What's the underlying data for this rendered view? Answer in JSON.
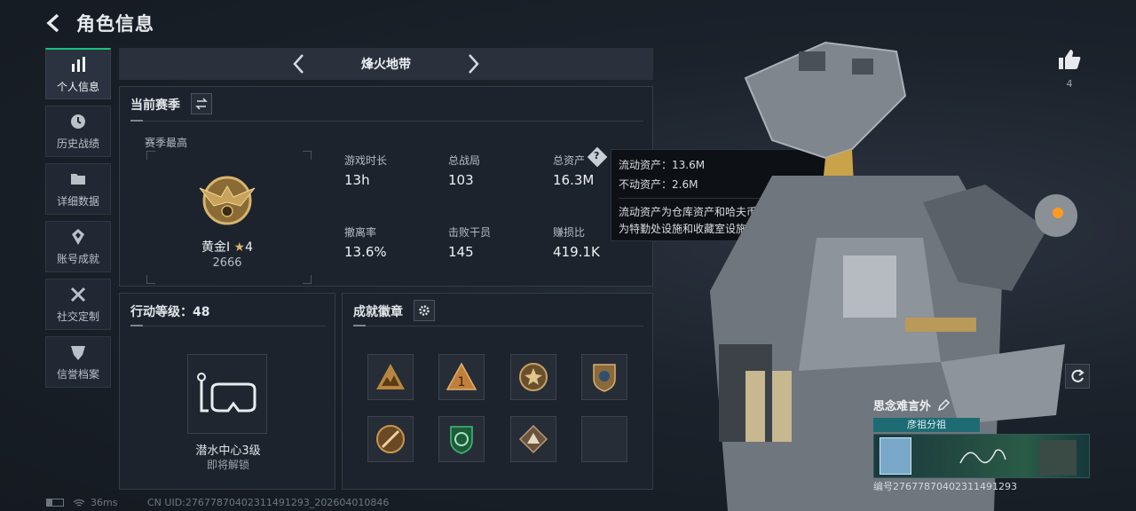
{
  "header": {
    "title": "角色信息"
  },
  "sidebar": {
    "items": [
      {
        "label": "个人信息",
        "icon": "bar-chart-icon"
      },
      {
        "label": "历史战绩",
        "icon": "clock-icon"
      },
      {
        "label": "详细数据",
        "icon": "folder-icon"
      },
      {
        "label": "账号成就",
        "icon": "achievement-icon"
      },
      {
        "label": "社交定制",
        "icon": "tools-icon"
      },
      {
        "label": "信誉档案",
        "icon": "shield-icon"
      }
    ]
  },
  "season": {
    "name": "烽火地带"
  },
  "current_season": {
    "title": "当前赛季",
    "highest_label": "赛季最高",
    "rank_name": "黄金Ⅰ",
    "rank_stars": "4",
    "rank_score": "2666",
    "stats": [
      {
        "label": "游戏时长",
        "value": "13h"
      },
      {
        "label": "总战局",
        "value": "103"
      },
      {
        "label": "总资产",
        "value": "16.3M"
      },
      {
        "label": "撤离率",
        "value": "13.6%"
      },
      {
        "label": "击败干员",
        "value": "145"
      },
      {
        "label": "赚损比",
        "value": "419.1K"
      }
    ]
  },
  "tooltip": {
    "liquid": "流动资产：13.6M",
    "fixed": "不动资产：2.6M",
    "desc1": "流动资产为仓库资产和哈夫币，不动资产",
    "desc2": "为特勤处设施和收藏室设施"
  },
  "action_level": {
    "title": "行动等级：48",
    "facility_name": "潜水中心3级",
    "facility_status": "即将解锁"
  },
  "achievements": {
    "title": "成就徽章"
  },
  "status": {
    "ping": "36ms",
    "uid": "CN UID:2767787040231149129​3_202604010846"
  },
  "like": {
    "count": "4"
  },
  "card": {
    "name": "思念难言外",
    "team": "彦祖分祖",
    "id": "编号2767787040231149129​3"
  },
  "colors": {
    "accent": "#19c27a",
    "panel": "#1c232c",
    "border": "#343c48"
  }
}
